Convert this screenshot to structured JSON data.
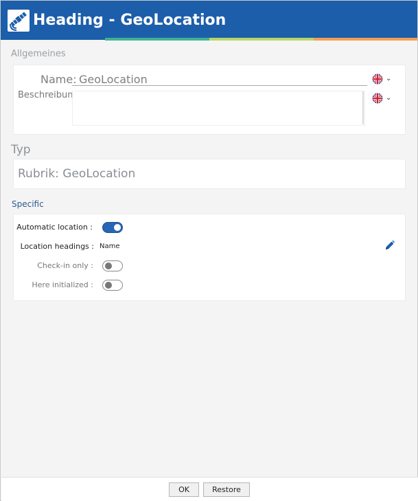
{
  "title": "Heading - GeoLocation",
  "colors": {
    "titlebar": "#1c5eaa",
    "stripe_1": "#3fb495",
    "stripe_2": "#b8d66a",
    "stripe_3": "#f0a052",
    "toggle_on": "#2767b3"
  },
  "general": {
    "section_label": "Allgemeines",
    "name_label": "Name:",
    "name_value": "GeoLocation",
    "description_label": "Beschreibung:",
    "description_value": "",
    "language_icon": "uk-flag-icon"
  },
  "type": {
    "section_label": "Typ",
    "value": "Rubrik: GeoLocation"
  },
  "specific": {
    "section_label": "Specific",
    "automatic_location": {
      "label": "Automatic location :",
      "on": true
    },
    "location_headings": {
      "label": "Location headings :",
      "value": "Name"
    },
    "checkin_only": {
      "label": "Check-in only :",
      "on": false
    },
    "here_initialized": {
      "label": "Here initialized :",
      "on": false
    }
  },
  "footer": {
    "ok_label": "OK",
    "restore_label": "Restore"
  }
}
